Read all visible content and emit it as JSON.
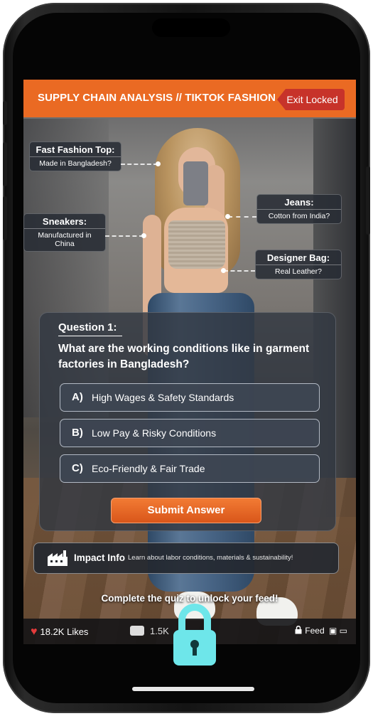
{
  "header": {
    "title": "SUPPLY CHAIN ANALYSIS // TIKTOK FASHION",
    "exit_label": "Exit Locked"
  },
  "tags": {
    "top": {
      "title": "Fast Fashion Top:",
      "detail": "Made in Bangladesh?"
    },
    "jeans": {
      "title": "Jeans:",
      "detail": "Cotton from India?"
    },
    "sneakers": {
      "title": "Sneakers:",
      "detail": "Manufactured in China"
    },
    "bag": {
      "title": "Designer Bag:",
      "detail": "Real Leather?"
    }
  },
  "quiz": {
    "label": "Question 1:",
    "question": "What are the working conditions like in garment factories in Bangladesh?",
    "options": [
      {
        "letter": "A)",
        "text": "High Wages & Safety Standards"
      },
      {
        "letter": "B)",
        "text": "Low Pay & Risky Conditions"
      },
      {
        "letter": "C)",
        "text": "Eco-Friendly & Fair Trade"
      }
    ],
    "submit_label": "Submit Answer"
  },
  "impact": {
    "title": "Impact Info",
    "description": "Learn about labor conditions, materials & sustainability!"
  },
  "unlock_prompt": "Complete the quiz to unlock your feed!",
  "bottom_bar": {
    "likes": "18.2K Likes",
    "comments": "1.5K",
    "feed_label": "Feed"
  },
  "colors": {
    "header": "#ea6a23",
    "exit": "#c7332a",
    "submit": "#e8661f",
    "lock": "#6ee6ea",
    "heart": "#e33b3b"
  },
  "icons": [
    "exit-arrow-icon",
    "factory-icon",
    "heart-icon",
    "comment-icon",
    "lock-icon",
    "padlock-icon"
  ]
}
